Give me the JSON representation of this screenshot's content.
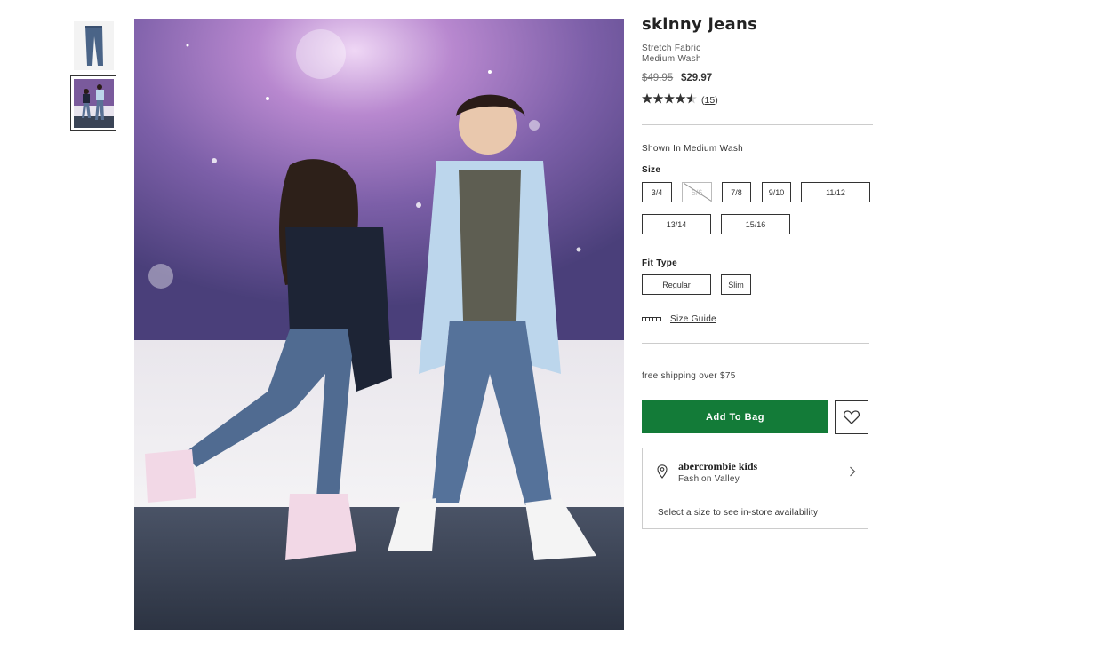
{
  "product": {
    "title": "skinny jeans",
    "features": [
      "Stretch Fabric",
      "Medium Wash"
    ],
    "price_original": "$49.95",
    "price_sale": "$29.97",
    "rating": 4.5,
    "rating_stars": "★★★★★",
    "review_count": "15"
  },
  "thumbnails": [
    {
      "icon": "jeans-thumbnail"
    },
    {
      "icon": "kids-model-thumbnail"
    }
  ],
  "shown_in": "Shown In Medium Wash",
  "size": {
    "label": "Size",
    "options": [
      "3/4",
      "5/6",
      "7/8",
      "9/10",
      "11/12",
      "13/14",
      "15/16"
    ],
    "unavailable": [
      "5/6"
    ]
  },
  "fit": {
    "label": "Fit Type",
    "options": [
      "Regular",
      "Slim"
    ]
  },
  "size_guide": "Size Guide",
  "shipping_note": "free shipping over $75",
  "add_to_bag": "Add To Bag",
  "store": {
    "name": "abercrombie kids",
    "location": "Fashion Valley",
    "availability_note": "Select a size to see in-store availability"
  },
  "colors": {
    "add_button": "#137b38",
    "text": "#333333"
  }
}
